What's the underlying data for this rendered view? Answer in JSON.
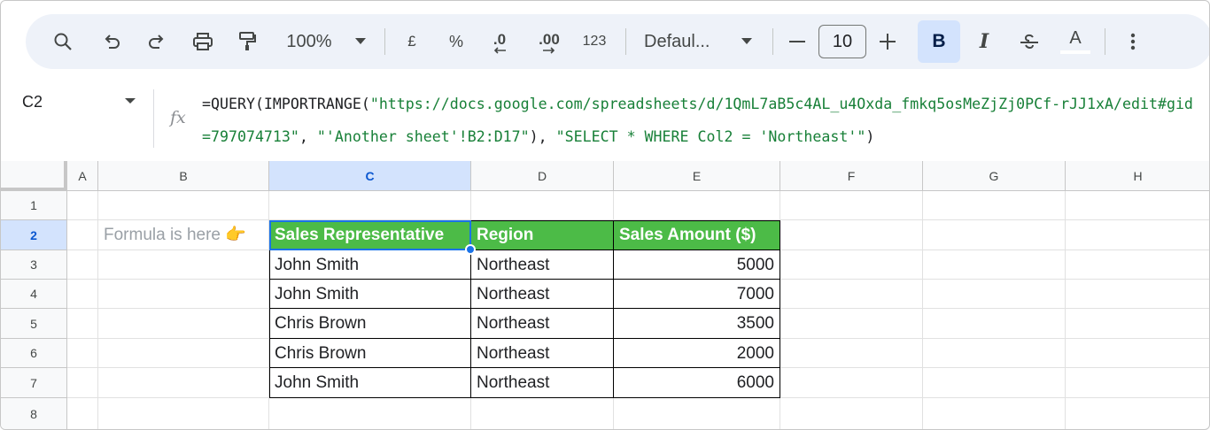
{
  "toolbar": {
    "zoom": "100%",
    "currency": "£",
    "percent": "%",
    "decrease_decimal": ".0",
    "increase_decimal": ".00",
    "number_format": "123",
    "font": "Defaul...",
    "font_size": "10",
    "bold": "B",
    "italic": "I",
    "text_color": "A"
  },
  "formula_bar": {
    "cell_ref": "C2",
    "fx": "fx",
    "formula_prefix": "=QUERY(IMPORTRANGE(",
    "url": "\"https://docs.google.com/spreadsheets/d/1QmL7aB5c4AL_u4Oxda_fmkq5osMeZjZj0PCf-rJJ1xA/edit#gid=797074713\"",
    "sep1": ", ",
    "range": "\"'Another sheet'!B2:D17\"",
    "sep2": "), ",
    "query": "\"SELECT * WHERE Col2 = 'Northeast'\"",
    "formula_suffix": ")"
  },
  "columns": [
    "A",
    "B",
    "C",
    "D",
    "E",
    "F",
    "G",
    "H"
  ],
  "rows": [
    "1",
    "2",
    "3",
    "4",
    "5",
    "6",
    "7",
    "8"
  ],
  "sheet": {
    "note": "Formula is here 👉",
    "headers": [
      "Sales Representative",
      "Region",
      "Sales Amount ($)"
    ],
    "data": [
      [
        "John Smith",
        "Northeast",
        "5000"
      ],
      [
        "John Smith",
        "Northeast",
        "7000"
      ],
      [
        "Chris Brown",
        "Northeast",
        "3500"
      ],
      [
        "Chris Brown",
        "Northeast",
        "2000"
      ],
      [
        "John Smith",
        "Northeast",
        "6000"
      ]
    ]
  },
  "colors": {
    "header_fill": "#4cbb47",
    "selection": "#1a73e8",
    "active_header": "#d3e3fd"
  }
}
